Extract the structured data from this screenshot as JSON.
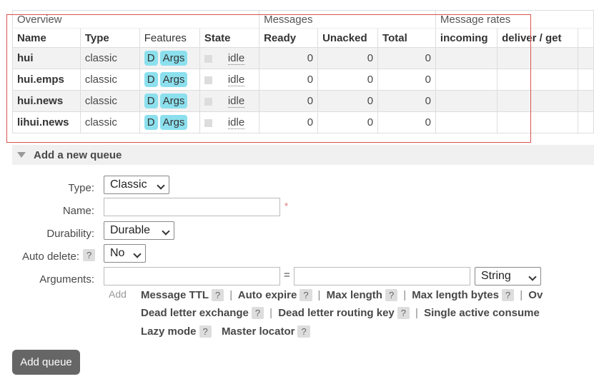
{
  "table": {
    "groups": {
      "overview": "Overview",
      "messages": "Messages",
      "rates": "Message rates"
    },
    "headers": {
      "name": "Name",
      "type": "Type",
      "features": "Features",
      "state": "State",
      "ready": "Ready",
      "unacked": "Unacked",
      "total": "Total",
      "incoming": "incoming",
      "deliver": "deliver / get"
    },
    "rows": [
      {
        "name": "hui",
        "type": "classic",
        "f1": "D",
        "f2": "Args",
        "state": "idle",
        "ready": "0",
        "unacked": "0",
        "total": "0"
      },
      {
        "name": "hui.emps",
        "type": "classic",
        "f1": "D",
        "f2": "Args",
        "state": "idle",
        "ready": "0",
        "unacked": "0",
        "total": "0"
      },
      {
        "name": "hui.news",
        "type": "classic",
        "f1": "D",
        "f2": "Args",
        "state": "idle",
        "ready": "0",
        "unacked": "0",
        "total": "0"
      },
      {
        "name": "lihui.news",
        "type": "classic",
        "f1": "D",
        "f2": "Args",
        "state": "idle",
        "ready": "0",
        "unacked": "0",
        "total": "0"
      }
    ]
  },
  "form": {
    "section_title": "Add a new queue",
    "type_label": "Type:",
    "type_value": "Classic",
    "name_label": "Name:",
    "name_value": "",
    "required_mark": "*",
    "durability_label": "Durability:",
    "durability_value": "Durable",
    "autodelete_label": "Auto delete:",
    "help": "?",
    "autodelete_value": "No",
    "arguments_label": "Arguments:",
    "equals": "=",
    "arg_type_value": "String",
    "add_label": "Add",
    "args": [
      "Message TTL",
      "Auto expire",
      "Max length",
      "Max length bytes",
      "Ov",
      "Dead letter exchange",
      "Dead letter routing key",
      "Single active consume",
      "Lazy mode",
      "Master locator"
    ],
    "separator": "|",
    "submit": "Add queue"
  }
}
